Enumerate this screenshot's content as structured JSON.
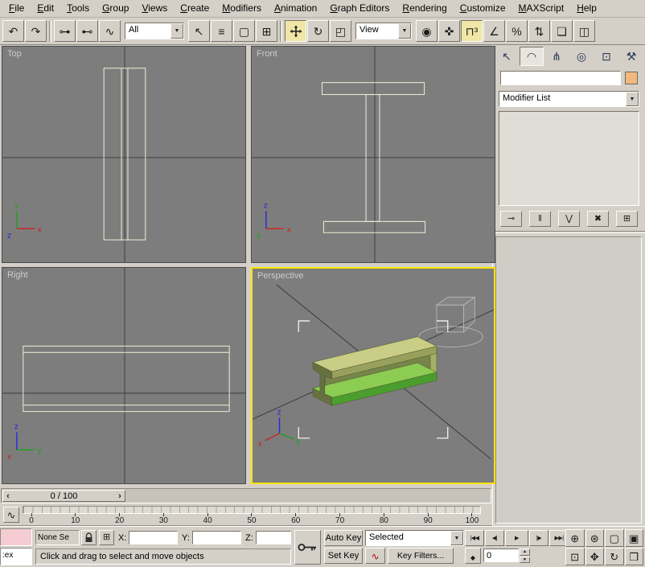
{
  "menu_bar": {
    "items": [
      {
        "label": "File"
      },
      {
        "label": "Edit"
      },
      {
        "label": "Tools"
      },
      {
        "label": "Group"
      },
      {
        "label": "Views"
      },
      {
        "label": "Create"
      },
      {
        "label": "Modifiers"
      },
      {
        "label": "Animation"
      },
      {
        "label": "Graph Editors"
      },
      {
        "label": "Rendering"
      },
      {
        "label": "Customize"
      },
      {
        "label": "MAXScript"
      },
      {
        "label": "Help"
      }
    ]
  },
  "toolbar": {
    "history_buttons": [
      {
        "name": "undo-button",
        "glyph": "↶"
      },
      {
        "name": "redo-button",
        "glyph": "↷"
      }
    ],
    "link_buttons": [
      {
        "name": "select-and-link-button",
        "glyph": "⊶"
      },
      {
        "name": "unlink-selection-button",
        "glyph": "⊷"
      },
      {
        "name": "bind-to-space-warp-button",
        "glyph": "∿"
      }
    ],
    "selection_filter_value": "All",
    "selection_buttons": [
      {
        "name": "select-object-button",
        "glyph": "↖"
      },
      {
        "name": "select-by-name-button",
        "glyph": "≡"
      },
      {
        "name": "rectangular-selection-region-button",
        "glyph": "▢"
      },
      {
        "name": "window-crossing-toggle",
        "glyph": "⊞"
      }
    ],
    "rotate_glyph": "↻",
    "scale_glyph": "◰",
    "reference_coord_value": "View",
    "right_buttons": [
      {
        "name": "use-pivot-point-center-button",
        "glyph": "◉"
      },
      {
        "name": "select-and-manipulate-button",
        "glyph": "✜"
      },
      {
        "name": "snaps-toggle",
        "glyph": "⊓³",
        "active": true
      },
      {
        "name": "angle-snap-toggle",
        "glyph": "∠"
      },
      {
        "name": "percent-snap-toggle",
        "glyph": "%"
      },
      {
        "name": "spinner-snap-toggle",
        "glyph": "⇅"
      },
      {
        "name": "edit-named-selection-sets-button",
        "glyph": "❏"
      },
      {
        "name": "mirror-button",
        "glyph": "◫"
      }
    ]
  },
  "viewports": {
    "top": {
      "label": "Top",
      "axis_up": "y",
      "axis_right": "x",
      "axis_origin": "z"
    },
    "front": {
      "label": "Front",
      "axis_up": "z",
      "axis_right": "x",
      "axis_origin": "y"
    },
    "right": {
      "label": "Right",
      "axis_up": "z",
      "axis_right": "y",
      "axis_origin": "x"
    },
    "perspective": {
      "label": "Perspective",
      "axis_up": "z",
      "axis_left": "x",
      "axis_right": "y"
    }
  },
  "command_panel": {
    "tabs": [
      {
        "name": "tab-create",
        "glyph": "↖"
      },
      {
        "name": "tab-modify",
        "glyph": "◠",
        "active": true
      },
      {
        "name": "tab-hierarchy",
        "glyph": "⋔"
      },
      {
        "name": "tab-motion",
        "glyph": "◎"
      },
      {
        "name": "tab-display",
        "glyph": "⊡"
      },
      {
        "name": "tab-utilities",
        "glyph": "⚒"
      }
    ],
    "object_name_field": {
      "value": ""
    },
    "modifier_list_label": "Modifier List",
    "stack_buttons": [
      {
        "name": "pin-stack-button",
        "glyph": "⊸"
      },
      {
        "name": "show-end-result-button",
        "glyph": "‖"
      },
      {
        "name": "make-unique-button",
        "glyph": "⋁"
      },
      {
        "name": "remove-modifier-button",
        "glyph": "✖"
      },
      {
        "name": "configure-modifier-sets-button",
        "glyph": "⊞"
      }
    ]
  },
  "time_controls": {
    "time_slider_label": "0 / 100",
    "trackbar_ticks": [
      "0",
      "10",
      "20",
      "30",
      "40",
      "50",
      "60",
      "70",
      "80",
      "90",
      "100"
    ],
    "frame_number": "0"
  },
  "status_bar": {
    "mini_listener_text": ":ex",
    "selection_status": "None Se",
    "coordinate_display": {
      "x_label": "X:",
      "y_label": "Y:",
      "z_label": "Z:",
      "x_value": "",
      "y_value": "",
      "z_value": ""
    },
    "prompt": "Click and drag to select and move objects",
    "auto_key_label": "Auto Key",
    "set_key_label": "Set Key",
    "key_filter_selection": "Selected",
    "key_filters_label": "Key Filters...",
    "playback_buttons": [
      {
        "name": "go-to-start-button",
        "glyph": "|◀◀"
      },
      {
        "name": "previous-frame-button",
        "glyph": "◀|"
      },
      {
        "name": "play-button",
        "glyph": "▶"
      },
      {
        "name": "next-frame-button",
        "glyph": "|▶"
      },
      {
        "name": "go-to-end-button",
        "glyph": "▶▶|"
      }
    ],
    "nav_buttons": [
      {
        "name": "zoom-button",
        "glyph": "⊕"
      },
      {
        "name": "zoom-all-button",
        "glyph": "⊛"
      },
      {
        "name": "zoom-extents-button",
        "glyph": "▢"
      },
      {
        "name": "zoom-extents-all-button",
        "glyph": "▣"
      },
      {
        "name": "region-zoom-button",
        "glyph": "⊡"
      },
      {
        "name": "pan-button",
        "glyph": "✥"
      },
      {
        "name": "arc-rotate-button",
        "glyph": "↻"
      },
      {
        "name": "min-max-toggle-button",
        "glyph": "❒"
      }
    ]
  },
  "icons": {
    "dropdown_arrow": "▼",
    "slider_left_arrow": "‹",
    "slider_right_arrow": "›",
    "spinner_up": "▲",
    "spinner_down": "▼",
    "mini_curve_editor": "∿",
    "new_key_tangent": "∿",
    "key_mode": "◆",
    "transform_typein": "⊞"
  },
  "colors": {
    "chrome": "#d4d0c8",
    "viewport_bg": "#7d7d7d",
    "viewport_label": "#cccccc",
    "grid_axis": "#3e3e3e",
    "wire": "#f0f0d8",
    "active_border": "#ffe400",
    "active_button_bg": "#f0e7a6",
    "axis_x": "#cc2020",
    "axis_y": "#20a020",
    "axis_z": "#2828d8",
    "beam_top": "#c9cd85",
    "beam_top_side": "#98a15c",
    "beam_web": "#76854a",
    "beam_bottom_top": "#8ccc52",
    "beam_bottom_side": "#4b9e2d",
    "beam_end": "#667140",
    "beam_far": "#a8b065",
    "bracket": "#ffffff",
    "swatch": "#f0b87a",
    "listener_pink": "#f5ccd2"
  }
}
